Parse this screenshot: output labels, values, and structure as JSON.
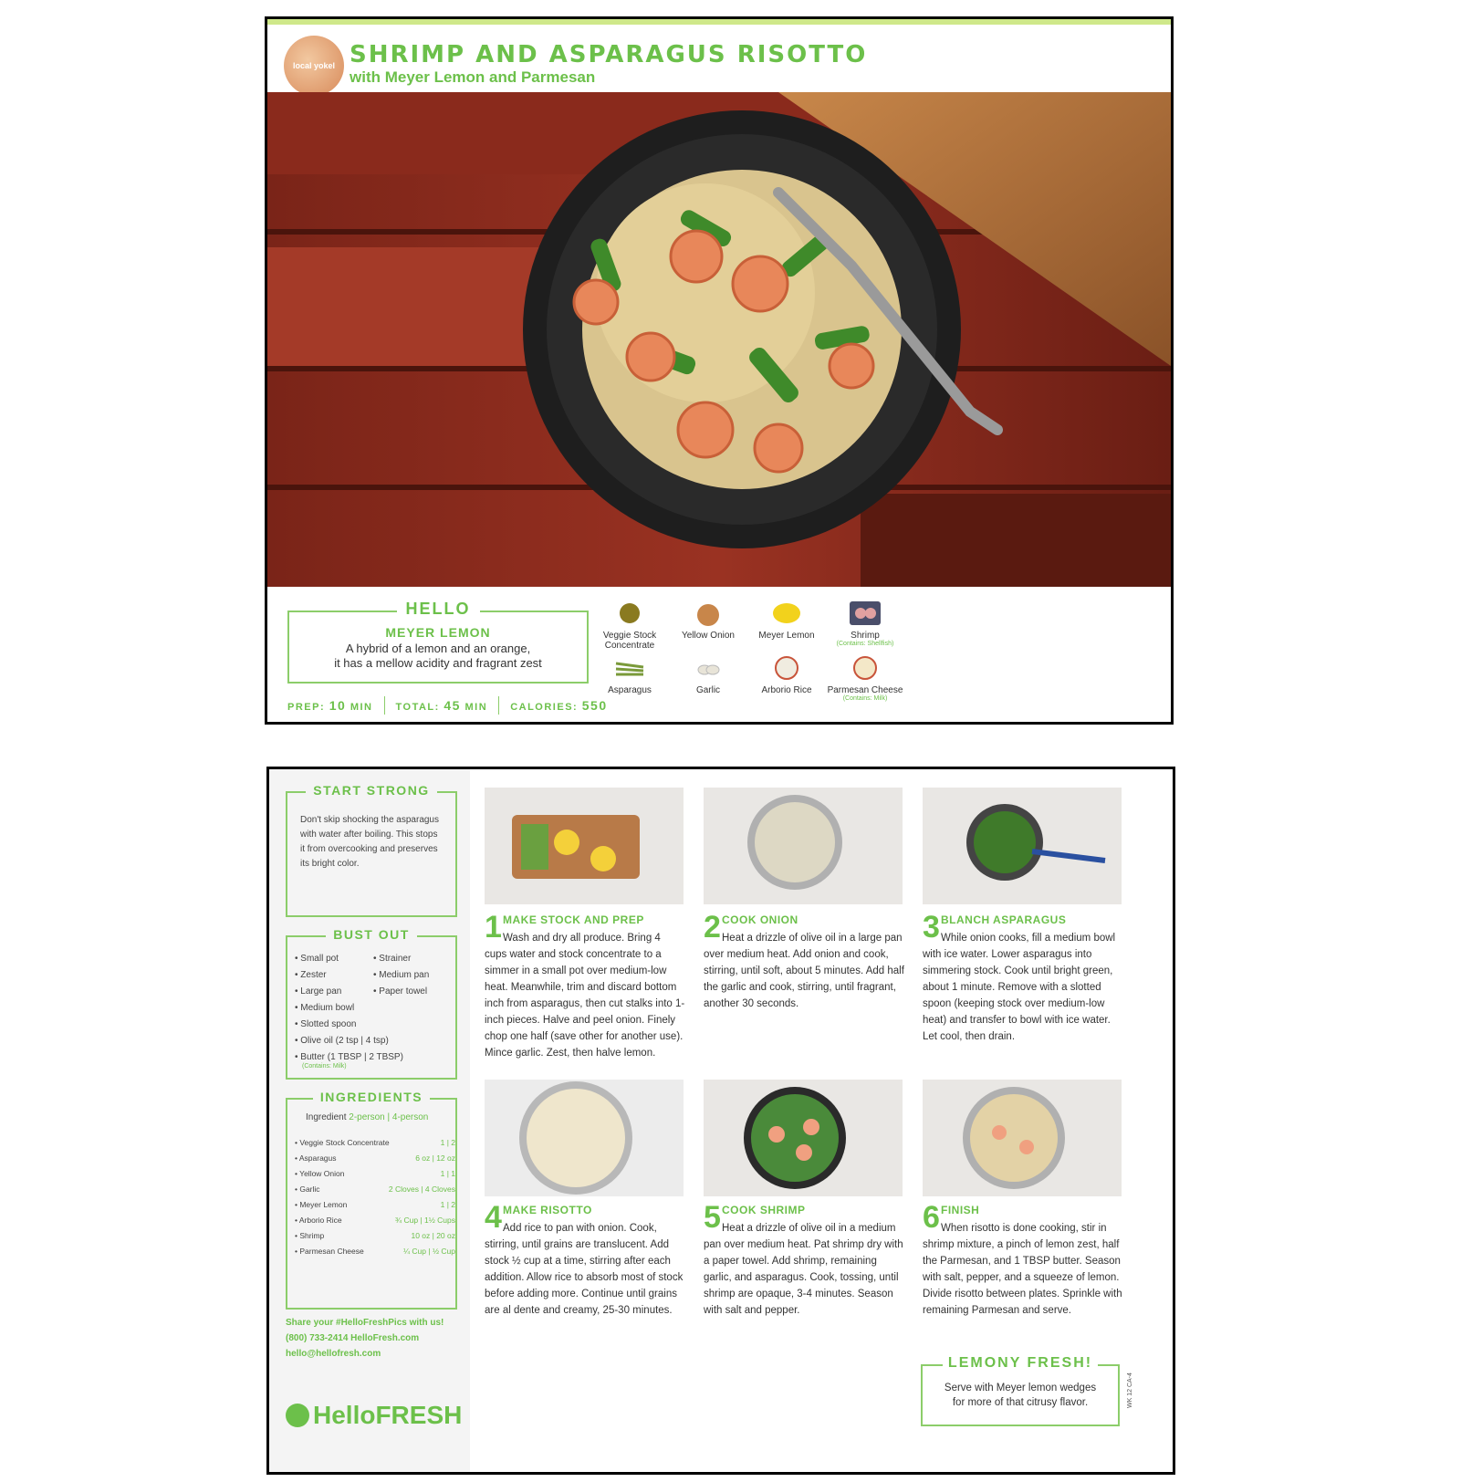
{
  "front": {
    "logo_text": "local yokel",
    "title": "SHRIMP AND ASPARAGUS RISOTTO",
    "subtitle": "with Meyer Lemon and Parmesan",
    "hello": {
      "heading": "HELLO",
      "name": "MEYER LEMON",
      "desc_line1": "A hybrid of a lemon and an orange,",
      "desc_line2": "it has a mellow acidity and fragrant zest"
    },
    "stats": {
      "prep_label": "PREP:",
      "prep_value": "10",
      "prep_unit": "MIN",
      "total_label": "TOTAL:",
      "total_value": "45",
      "total_unit": "MIN",
      "calories_label": "CALORIES:",
      "calories_value": "550"
    },
    "ingredients": [
      {
        "name": "Veggie Stock",
        "name2": "Concentrate",
        "note": "",
        "icon": "stock-icon",
        "color": "#8a7a20"
      },
      {
        "name": "Yellow Onion",
        "name2": "",
        "note": "",
        "icon": "onion-icon",
        "color": "#c8864a"
      },
      {
        "name": "Meyer Lemon",
        "name2": "",
        "note": "",
        "icon": "lemon-icon",
        "color": "#f2d21c"
      },
      {
        "name": "Shrimp",
        "name2": "",
        "note": "(Contains: Shellfish)",
        "icon": "shrimp-icon",
        "color": "#e0a0a0"
      },
      {
        "name": "Asparagus",
        "name2": "",
        "note": "",
        "icon": "asparagus-icon",
        "color": "#7a9a3a"
      },
      {
        "name": "Garlic",
        "name2": "",
        "note": "",
        "icon": "garlic-icon",
        "color": "#e8e4d8"
      },
      {
        "name": "Arborio Rice",
        "name2": "",
        "note": "",
        "icon": "rice-icon",
        "color": "#f0ece0"
      },
      {
        "name": "Parmesan Cheese",
        "name2": "",
        "note": "(Contains: Milk)",
        "icon": "parmesan-icon",
        "color": "#f4e8c8"
      }
    ]
  },
  "back": {
    "start_strong": {
      "heading": "START STRONG",
      "tip": "Don't skip shocking the asparagus with water after boiling. This stops it from overcooking and preserves its bright color."
    },
    "bust_out": {
      "heading": "BUST OUT",
      "left": [
        "• Small pot",
        "• Zester",
        "• Large pan",
        "• Medium bowl",
        "• Slotted spoon",
        "• Olive oil (2 tsp | 4 tsp)",
        "• Butter (1 TBSP | 2 TBSP)"
      ],
      "right": [
        "• Strainer",
        "• Medium pan",
        "• Paper towel"
      ],
      "butter_note": "(Contains: Milk)"
    },
    "ingredients": {
      "heading": "INGREDIENTS",
      "col_label": "Ingredient",
      "col_sizes": "2-person | 4-person",
      "rows": [
        {
          "name": "• Veggie Stock Concentrate",
          "amount": "1 | 2"
        },
        {
          "name": "• Asparagus",
          "amount": "6 oz | 12 oz"
        },
        {
          "name": "• Yellow Onion",
          "amount": "1 | 1"
        },
        {
          "name": "• Garlic",
          "amount": "2 Cloves | 4 Cloves"
        },
        {
          "name": "• Meyer Lemon",
          "amount": "1 | 2"
        },
        {
          "name": "• Arborio Rice",
          "amount": "¾ Cup | 1½ Cups"
        },
        {
          "name": "• Shrimp",
          "amount": "10 oz | 20 oz"
        },
        {
          "name": "• Parmesan Cheese",
          "amount": "¼ Cup | ½ Cup"
        }
      ]
    },
    "share": {
      "line1": "Share your #HelloFreshPics with us!",
      "line2": "(800) 733-2414 HelloFresh.com",
      "line3": "hello@hellofresh.com"
    },
    "brand": "HelloFRESH",
    "steps": [
      {
        "num": "1",
        "title": "MAKE STOCK AND PREP",
        "body": "Wash and dry all produce. Bring 4 cups water and stock concentrate to a simmer in a small pot over medium-low heat. Meanwhile, trim and discard bottom inch from asparagus, then cut stalks into 1-inch pieces. Halve and peel onion. Finely chop one half (save other for another use). Mince garlic. Zest, then halve lemon."
      },
      {
        "num": "2",
        "title": "COOK ONION",
        "body": "Heat a drizzle of olive oil in a large pan over medium heat. Add onion and cook, stirring, until soft, about 5 minutes. Add half the garlic and cook, stirring, until fragrant, another 30 seconds."
      },
      {
        "num": "3",
        "title": "BLANCH ASPARAGUS",
        "body": "While onion cooks, fill a medium bowl with ice water. Lower asparagus into simmering stock. Cook until bright green, about 1 minute. Remove with a slotted spoon (keeping stock over medium-low heat) and transfer to bowl with ice water. Let cool, then drain."
      },
      {
        "num": "4",
        "title": "MAKE RISOTTO",
        "body": "Add rice to pan with onion. Cook, stirring, until grains are translucent. Add stock ½ cup at a time, stirring after each addition. Allow rice to absorb most of stock before adding more. Continue until grains are al dente and creamy, 25-30 minutes."
      },
      {
        "num": "5",
        "title": "COOK SHRIMP",
        "body": "Heat a drizzle of olive oil in a medium pan over medium heat. Pat shrimp dry with a paper towel. Add shrimp, remaining garlic, and asparagus. Cook, tossing, until shrimp are opaque, 3-4 minutes. Season with salt and pepper."
      },
      {
        "num": "6",
        "title": "FINISH",
        "body": "When risotto is done cooking, stir in shrimp mixture, a pinch of lemon zest, half the Parmesan, and 1 TBSP butter. Season with salt, pepper, and a squeeze of lemon. Divide risotto between plates. Sprinkle with remaining Parmesan and serve."
      }
    ],
    "lemony": {
      "heading": "LEMONY FRESH!",
      "line1": "Serve with Meyer lemon wedges",
      "line2": "for more of that citrusy flavor."
    },
    "code": "WK 12 CA-4"
  }
}
